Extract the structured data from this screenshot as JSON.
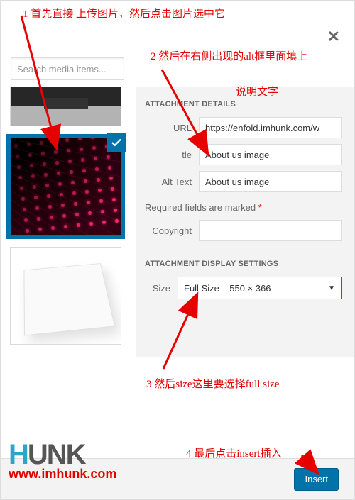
{
  "annotations": {
    "step1": "1 首先直接 上传图片，然后点击图片选中它",
    "step2_line1": "2 然后在右侧出现的alt框里面填上",
    "step2_line2": "说明文字",
    "step3": "3 然后size这里要选择full size",
    "step4": "4  最后点击insert插入"
  },
  "search": {
    "placeholder": "Search media items..."
  },
  "details": {
    "section_title": "ATTACHMENT DETAILS",
    "url": {
      "label": "URL",
      "value": "https://enfold.imhunk.com/w"
    },
    "title": {
      "label": "tle",
      "value": "About us image"
    },
    "alt": {
      "label": "Alt Text",
      "value": "About us image"
    },
    "required_text": "Required fields are marked ",
    "required_star": "*",
    "copyright": {
      "label": "Copyright",
      "value": ""
    }
  },
  "display": {
    "section_title": "ATTACHMENT DISPLAY SETTINGS",
    "size": {
      "label": "Size",
      "value": "Full Size – 550 × 366"
    }
  },
  "footer": {
    "insert": "Insert"
  },
  "branding": {
    "logo_h": "H",
    "logo_rest": "UNK",
    "site": "www.imhunk.com"
  }
}
